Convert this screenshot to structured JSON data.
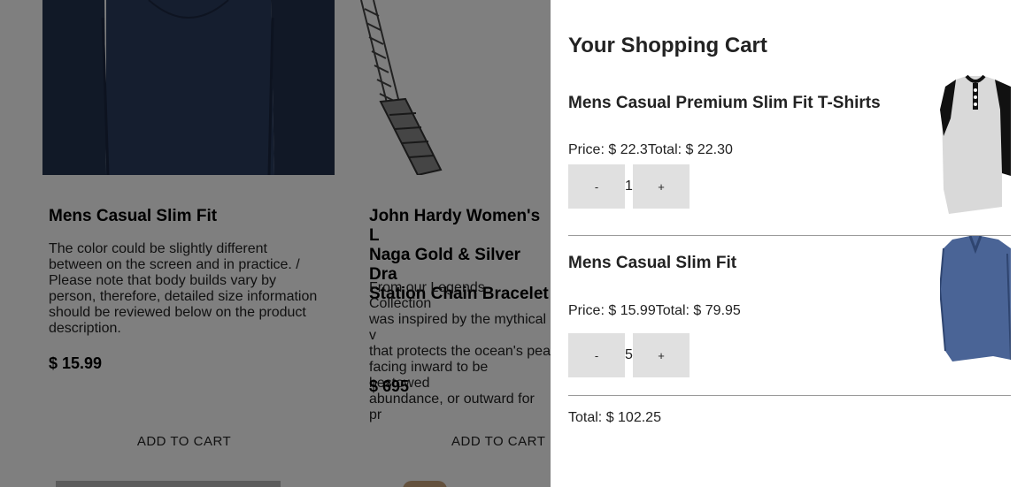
{
  "products": [
    {
      "title_lines": [
        "Mens Casual Slim Fit"
      ],
      "description_lines": [
        "The color could be slightly different",
        "between on the screen and in practice. /",
        "Please note that body builds vary by",
        "person, therefore, detailed size information",
        "should be reviewed below on the product",
        "description."
      ],
      "price": "$ 15.99",
      "button": "ADD TO CART",
      "image": "navy-long-sleeve-shirt"
    },
    {
      "title_lines": [
        "John Hardy Women's L",
        "Naga Gold & Silver Dra",
        "Station Chain Bracelet"
      ],
      "description_lines": [
        "From our Legends Collection",
        "was inspired by the mythical v",
        "that protects the ocean's pea",
        "facing inward to be bestowed",
        "abundance, or outward for pr"
      ],
      "price": "$ 695",
      "button": "ADD TO CART",
      "image": "silver-chain-bracelet"
    }
  ],
  "cart": {
    "title": "Your Shopping Cart",
    "items": [
      {
        "name": "Mens Casual Premium Slim Fit T-Shirts",
        "price_label": "Price: $ 22.3",
        "total_label": "Total: $ 22.30",
        "minus": "-",
        "quantity": "1",
        "plus": "+",
        "image": "henley-raglan-shirt"
      },
      {
        "name": "Mens Casual Slim Fit",
        "price_label": "Price: $ 15.99",
        "total_label": "Total: $ 79.95",
        "minus": "-",
        "quantity": "5",
        "plus": "+",
        "image": "blue-vneck-long-sleeve-shirt"
      }
    ],
    "total_label": "Total: $ 102.25"
  },
  "colors": {
    "overlay": "rgba(0,0,0,0.5)",
    "qty_button_bg": "#e0e0e0",
    "divider": "#9a9a9a"
  }
}
